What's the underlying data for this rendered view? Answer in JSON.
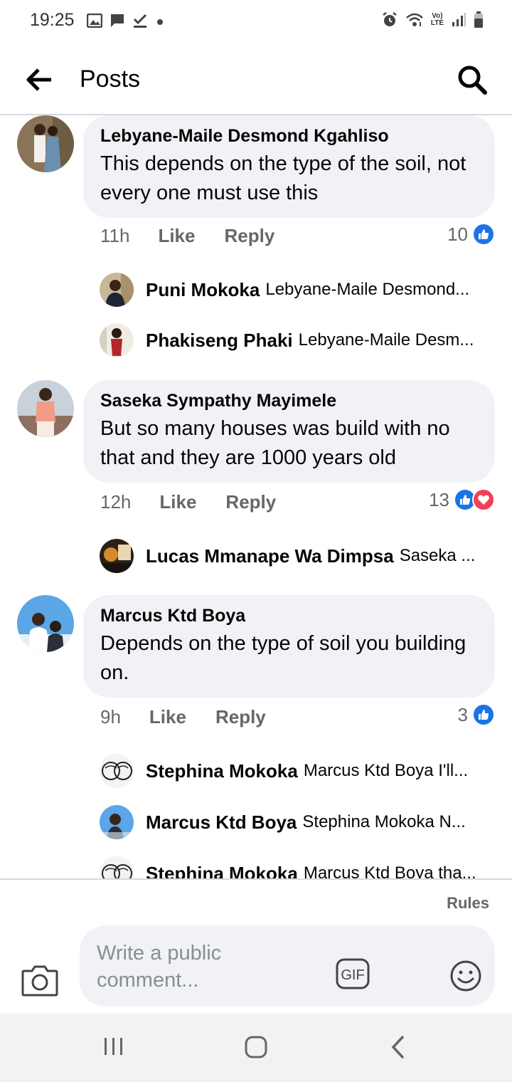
{
  "status_bar": {
    "time": "19:25",
    "left_icons": [
      "image-icon",
      "message-icon",
      "check-icon",
      "dot-icon"
    ],
    "right_icons": [
      "alarm-icon",
      "wifi-icon",
      "volte-icon",
      "signal-icon",
      "battery-icon"
    ],
    "volte_top": "Vo)",
    "volte_bottom": "LTE"
  },
  "header": {
    "title": "Posts",
    "back_icon": "arrow-left-icon",
    "search_icon": "search-icon"
  },
  "comments": [
    {
      "author": "Lebyane-Maile Desmond Kgahliso",
      "text": "This depends on the type of the soil, not every one must use this",
      "time": "11h",
      "like_label": "Like",
      "reply_label": "Reply",
      "reaction_count": "10",
      "reactions": [
        "like"
      ],
      "replies": [
        {
          "author": "Puni Mokoka",
          "preview": "Lebyane-Maile Desmond..."
        },
        {
          "author": "Phakiseng Phaki",
          "preview": "Lebyane-Maile Desm..."
        }
      ]
    },
    {
      "author": "Saseka Sympathy Mayimele",
      "text": "But so many houses was build with no that and they are 1000 years old",
      "time": "12h",
      "like_label": "Like",
      "reply_label": "Reply",
      "reaction_count": "13",
      "reactions": [
        "like",
        "love"
      ],
      "replies": [
        {
          "author": "Lucas Mmanape Wa Dimpsa",
          "preview": "Saseka ..."
        }
      ]
    },
    {
      "author": "Marcus Ktd Boya",
      "text": "Depends on the  type of soil you building on.",
      "time": "9h",
      "like_label": "Like",
      "reply_label": "Reply",
      "reaction_count": "3",
      "reactions": [
        "like"
      ],
      "replies": [
        {
          "author": "Stephina Mokoka",
          "preview": "Marcus Ktd Boya I'll..."
        },
        {
          "author": "Marcus Ktd Boya",
          "preview": "Stephina Mokoka  N..."
        },
        {
          "author": "Stephina Mokoka",
          "preview": "Marcus Ktd Boya tha..."
        }
      ]
    }
  ],
  "composer": {
    "rules_label": "Rules",
    "placeholder": "Write a public comment...",
    "gif_label": "GIF",
    "camera_icon": "camera-icon",
    "emoji_icon": "smiley-icon"
  },
  "colors": {
    "bubble": "#f0f2f5",
    "secondary_text": "#65676b",
    "like_blue": "#1b74e4",
    "love_red": "#f33e58"
  }
}
